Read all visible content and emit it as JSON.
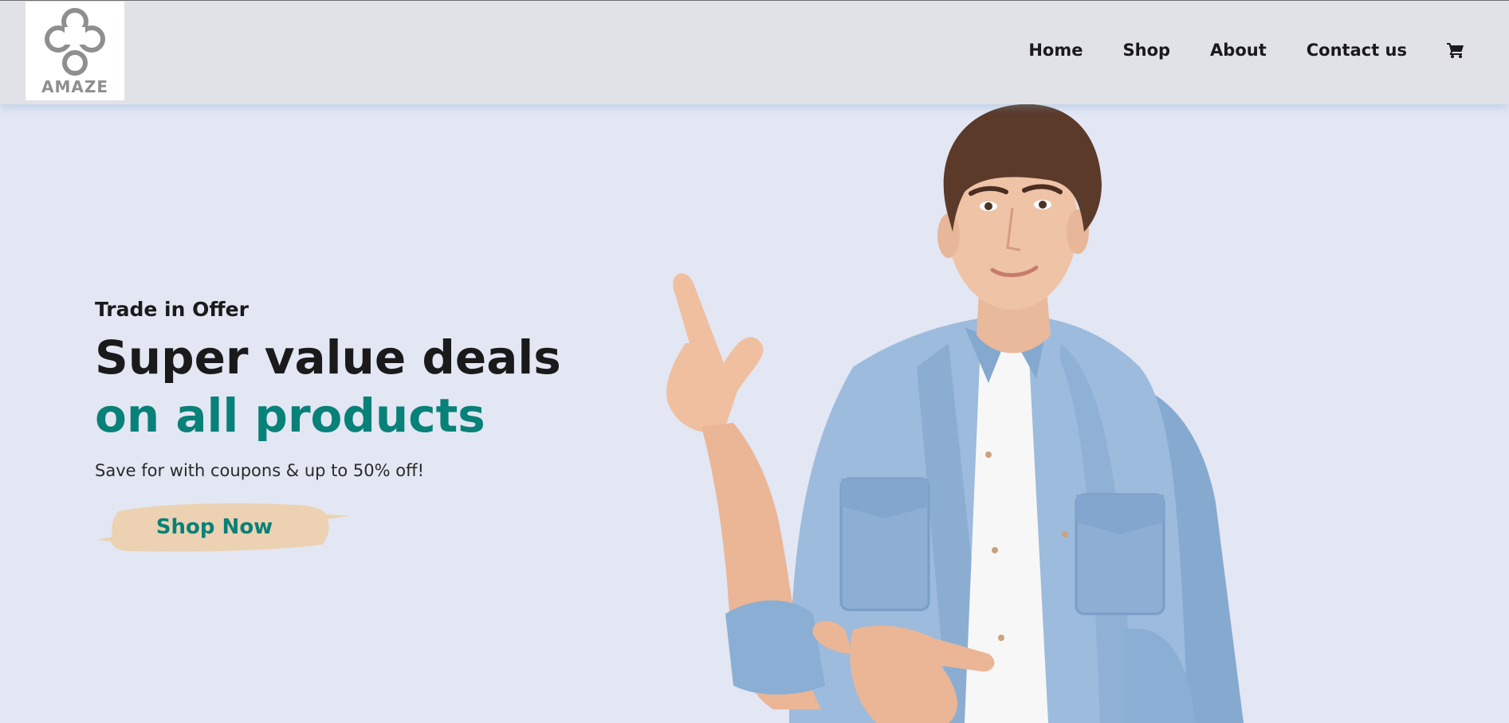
{
  "header": {
    "logo": {
      "text": "AMAZE",
      "icon": "amaze-logo-icon"
    },
    "nav": [
      {
        "label": "Home"
      },
      {
        "label": "Shop"
      },
      {
        "label": "About"
      },
      {
        "label": "Contact us"
      }
    ],
    "cart_icon": "shopping-cart-icon"
  },
  "hero": {
    "eyebrow": "Trade in Offer",
    "headline_line1": "Super value deals",
    "headline_line2": "on all products",
    "subtext": "Save for with coupons & up to 50% off!",
    "button_label": "Shop Now",
    "image": "man-in-denim-shirt-pointing-photo"
  },
  "colors": {
    "background": "#e3e6f3",
    "header_bg": "#e1e1e8",
    "accent": "#088178",
    "button_bg": "#ecd2b2",
    "text": "#1a1a1a",
    "logo_gray": "#8f8f8f"
  }
}
